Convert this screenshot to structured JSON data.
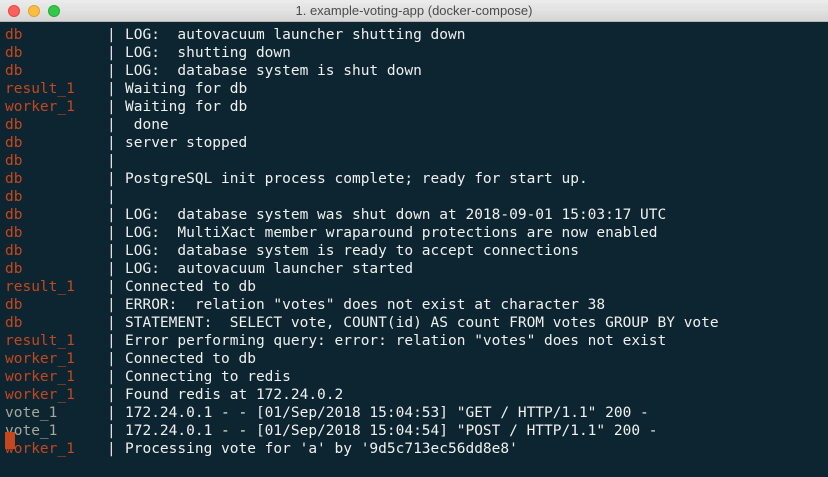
{
  "window": {
    "title": "1. example-voting-app (docker-compose)"
  },
  "colors": {
    "background": "#0c2530",
    "service_default": "#c4471f",
    "service_vote": "#a8a89a",
    "text": "#f0f0f0"
  },
  "lines": [
    {
      "svc": "db",
      "kind": "db",
      "sep": "|",
      "msg": "LOG:  autovacuum launcher shutting down"
    },
    {
      "svc": "db",
      "kind": "db",
      "sep": "|",
      "msg": "LOG:  shutting down"
    },
    {
      "svc": "db",
      "kind": "db",
      "sep": "|",
      "msg": "LOG:  database system is shut down"
    },
    {
      "svc": "result_1",
      "kind": "result",
      "sep": "|",
      "msg": "Waiting for db"
    },
    {
      "svc": "worker_1",
      "kind": "worker",
      "sep": "|",
      "msg": "Waiting for db"
    },
    {
      "svc": "db",
      "kind": "db",
      "sep": "|",
      "msg": " done"
    },
    {
      "svc": "db",
      "kind": "db",
      "sep": "|",
      "msg": "server stopped"
    },
    {
      "svc": "db",
      "kind": "db",
      "sep": "|",
      "msg": ""
    },
    {
      "svc": "db",
      "kind": "db",
      "sep": "|",
      "msg": "PostgreSQL init process complete; ready for start up."
    },
    {
      "svc": "db",
      "kind": "db",
      "sep": "|",
      "msg": ""
    },
    {
      "svc": "db",
      "kind": "db",
      "sep": "|",
      "msg": "LOG:  database system was shut down at 2018-09-01 15:03:17 UTC"
    },
    {
      "svc": "db",
      "kind": "db",
      "sep": "|",
      "msg": "LOG:  MultiXact member wraparound protections are now enabled"
    },
    {
      "svc": "db",
      "kind": "db",
      "sep": "|",
      "msg": "LOG:  database system is ready to accept connections"
    },
    {
      "svc": "db",
      "kind": "db",
      "sep": "|",
      "msg": "LOG:  autovacuum launcher started"
    },
    {
      "svc": "result_1",
      "kind": "result",
      "sep": "|",
      "msg": "Connected to db"
    },
    {
      "svc": "db",
      "kind": "db",
      "sep": "|",
      "msg": "ERROR:  relation \"votes\" does not exist at character 38"
    },
    {
      "svc": "db",
      "kind": "db",
      "sep": "|",
      "msg": "STATEMENT:  SELECT vote, COUNT(id) AS count FROM votes GROUP BY vote"
    },
    {
      "svc": "result_1",
      "kind": "result",
      "sep": "|",
      "msg": "Error performing query: error: relation \"votes\" does not exist"
    },
    {
      "svc": "worker_1",
      "kind": "worker",
      "sep": "|",
      "msg": "Connected to db"
    },
    {
      "svc": "worker_1",
      "kind": "worker",
      "sep": "|",
      "msg": "Connecting to redis"
    },
    {
      "svc": "worker_1",
      "kind": "worker",
      "sep": "|",
      "msg": "Found redis at 172.24.0.2"
    },
    {
      "svc": "vote_1",
      "kind": "vote",
      "sep": "|",
      "msg": "172.24.0.1 - - [01/Sep/2018 15:04:53] \"GET / HTTP/1.1\" 200 -"
    },
    {
      "svc": "vote_1",
      "kind": "vote",
      "sep": "|",
      "msg": "172.24.0.1 - - [01/Sep/2018 15:04:54] \"POST / HTTP/1.1\" 200 -"
    },
    {
      "svc": "worker_1",
      "kind": "worker",
      "sep": "|",
      "msg": "Processing vote for 'a' by '9d5c713ec56dd8e8'"
    }
  ]
}
